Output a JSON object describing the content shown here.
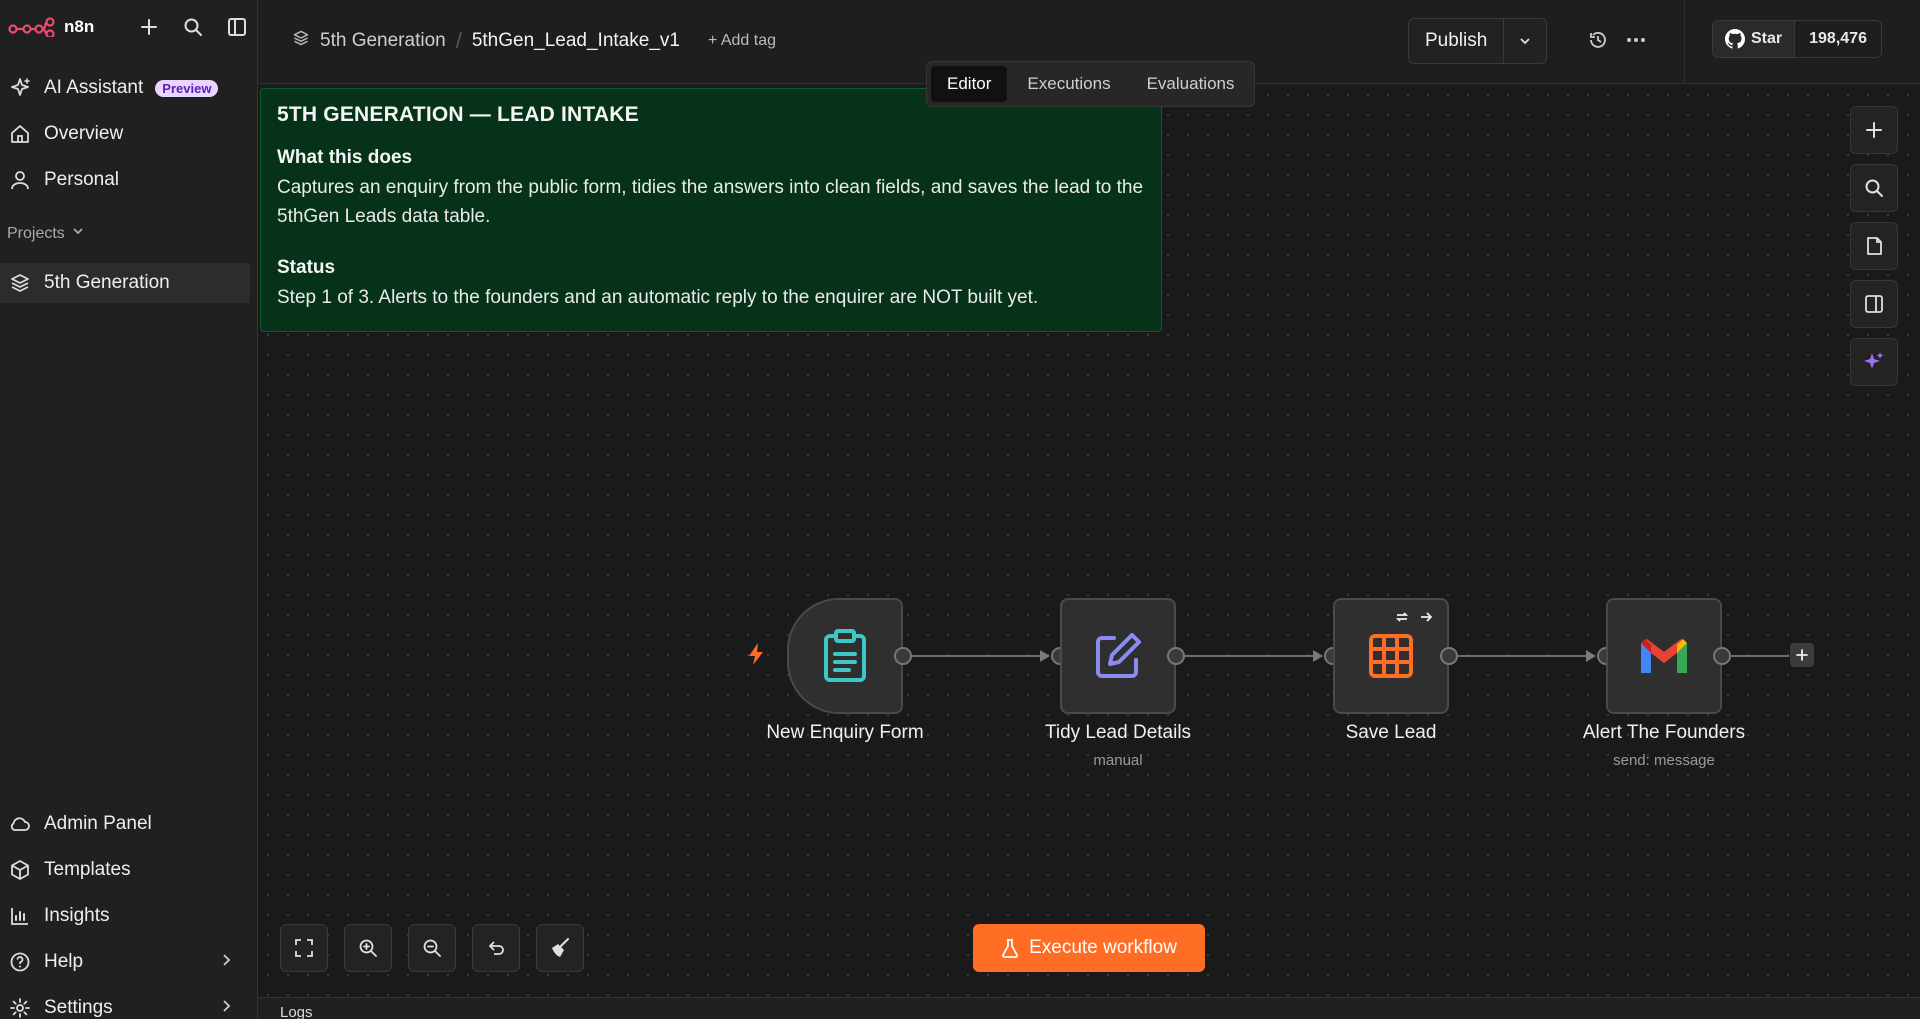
{
  "app": {
    "name": "n8n"
  },
  "sidebar": {
    "top_items": [
      {
        "label": "AI Assistant",
        "badge": "Preview",
        "icon": "sparkles-icon"
      },
      {
        "label": "Overview",
        "icon": "home-icon"
      },
      {
        "label": "Personal",
        "icon": "user-icon"
      }
    ],
    "projects_label": "Projects",
    "project": {
      "label": "5th Generation",
      "icon": "layers-icon"
    },
    "bottom_items": [
      {
        "label": "Admin Panel",
        "icon": "cloud-icon"
      },
      {
        "label": "Templates",
        "icon": "box-icon"
      },
      {
        "label": "Insights",
        "icon": "bar-chart-icon"
      },
      {
        "label": "Help",
        "icon": "help-circle-icon"
      },
      {
        "label": "Settings",
        "icon": "gear-icon"
      }
    ]
  },
  "header": {
    "project": "5th Generation",
    "workflow_name": "5thGen_Lead_Intake_v1",
    "add_tag": "+ Add tag",
    "publish": "Publish",
    "github_star": "Star",
    "github_count": "198,476"
  },
  "tabs": [
    {
      "label": "Editor",
      "active": true
    },
    {
      "label": "Executions",
      "active": false
    },
    {
      "label": "Evaluations",
      "active": false
    }
  ],
  "sticky": {
    "title": "5TH GENERATION — LEAD INTAKE",
    "h1": "What this does",
    "p1": "Captures an enquiry from the public form, tidies the answers into clean fields, and saves the lead to the 5thGen Leads data table.",
    "h2": "Status",
    "p2": "Step 1 of 3. Alerts to the founders and an automatic reply to the enquirer are NOT built yet."
  },
  "nodes": [
    {
      "label": "New Enquiry Form",
      "subtitle": "",
      "icon": "clipboard-icon",
      "color": "#3fc7c7"
    },
    {
      "label": "Tidy Lead Details",
      "subtitle": "manual",
      "icon": "edit-icon",
      "color": "#8b8cf0"
    },
    {
      "label": "Save Lead",
      "subtitle": "",
      "icon": "table-icon",
      "color": "#ff6d24"
    },
    {
      "label": "Alert The Founders",
      "subtitle": "send: message",
      "icon": "gmail-icon",
      "color": "#ea4335"
    }
  ],
  "execute_button": "Execute workflow",
  "logs_label": "Logs",
  "colors": {
    "accent": "#ff6d24",
    "sticky_bg": "#06321a",
    "canvas_bg": "#1a1a1a"
  }
}
